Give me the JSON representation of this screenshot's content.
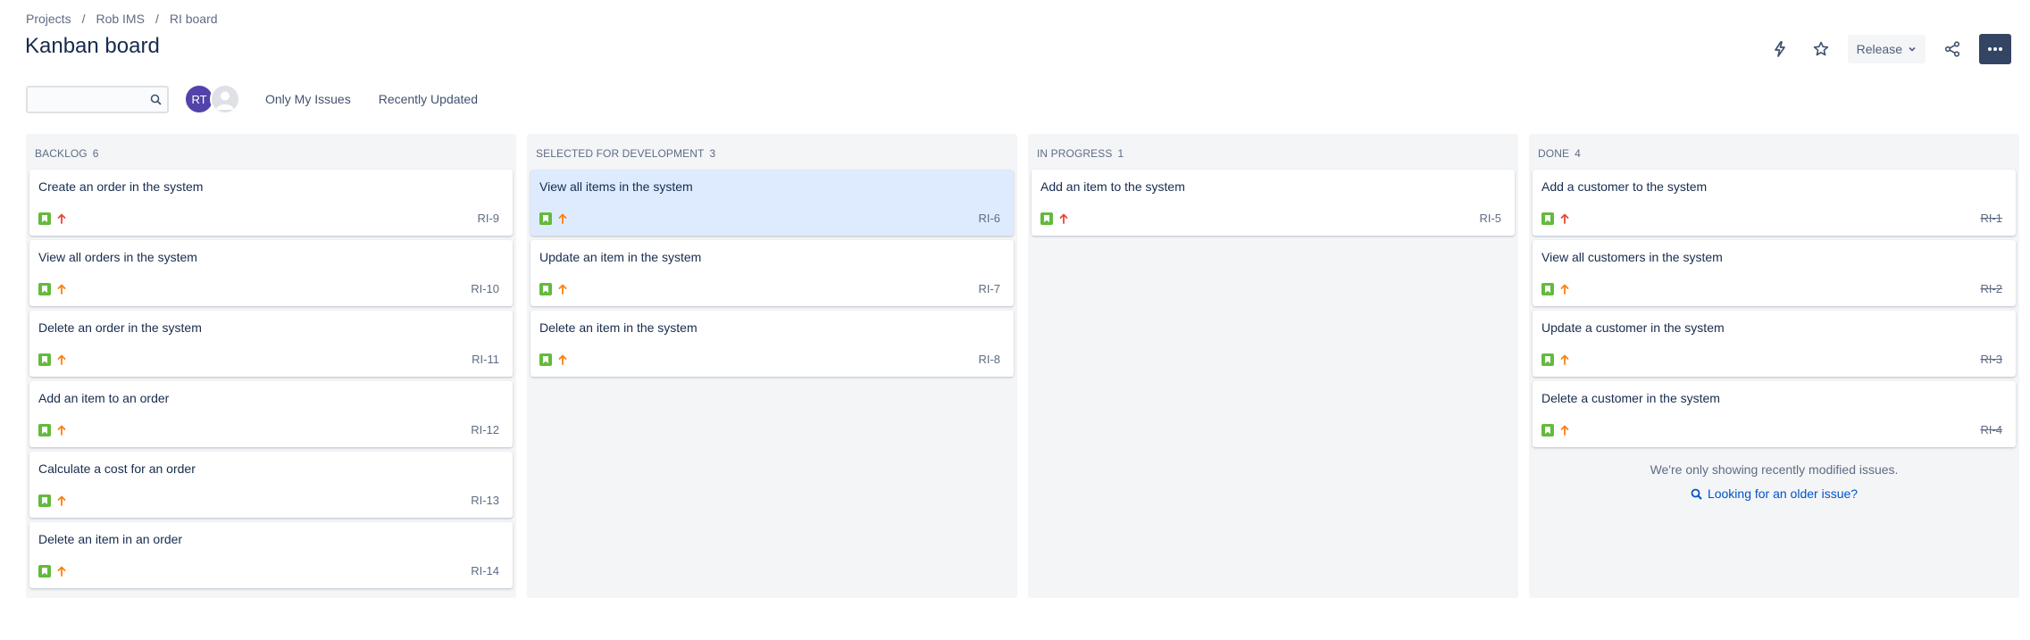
{
  "breadcrumb": [
    "Projects",
    "Rob IMS",
    "RI board"
  ],
  "breadcrumb_sep": "/",
  "page": {
    "title": "Kanban board"
  },
  "header": {
    "release_label": "Release"
  },
  "toolbar": {
    "search_placeholder": "",
    "avatar_initials": "RT",
    "filters": [
      "Only My Issues",
      "Recently Updated"
    ]
  },
  "colors": {
    "story": "#63ba3c",
    "priority_high": "#e5493a",
    "priority_medium": "#ff7f0e",
    "selected_card": "#deebff",
    "link": "#0052cc"
  },
  "columns": [
    {
      "title": "BACKLOG",
      "count": "6",
      "cards": [
        {
          "title": "Create an order in the system",
          "key": "RI-9",
          "priority": "high"
        },
        {
          "title": "View all orders in the system",
          "key": "RI-10",
          "priority": "medium"
        },
        {
          "title": "Delete an order in the system",
          "key": "RI-11",
          "priority": "medium"
        },
        {
          "title": "Add an item to an order",
          "key": "RI-12",
          "priority": "medium"
        },
        {
          "title": "Calculate a cost for an order",
          "key": "RI-13",
          "priority": "medium"
        },
        {
          "title": "Delete an item in an order",
          "key": "RI-14",
          "priority": "medium"
        }
      ]
    },
    {
      "title": "SELECTED FOR DEVELOPMENT",
      "count": "3",
      "cards": [
        {
          "title": "View all items in the system",
          "key": "RI-6",
          "priority": "medium",
          "selected": true
        },
        {
          "title": "Update an item in the system",
          "key": "RI-7",
          "priority": "medium"
        },
        {
          "title": "Delete an item in the system",
          "key": "RI-8",
          "priority": "medium"
        }
      ]
    },
    {
      "title": "IN PROGRESS",
      "count": "1",
      "cards": [
        {
          "title": "Add an item to the system",
          "key": "RI-5",
          "priority": "high"
        }
      ]
    },
    {
      "title": "DONE",
      "count": "4",
      "cards": [
        {
          "title": "Add a customer to the system",
          "key": "RI-1",
          "priority": "highest",
          "done": true
        },
        {
          "title": "View all customers in the system",
          "key": "RI-2",
          "priority": "medium",
          "done": true
        },
        {
          "title": "Update a customer in the system",
          "key": "RI-3",
          "priority": "medium",
          "done": true
        },
        {
          "title": "Delete a customer in the system",
          "key": "RI-4",
          "priority": "medium",
          "done": true
        }
      ],
      "footer_note": "We're only showing recently modified issues.",
      "footer_link": "Looking for an older issue?"
    }
  ]
}
